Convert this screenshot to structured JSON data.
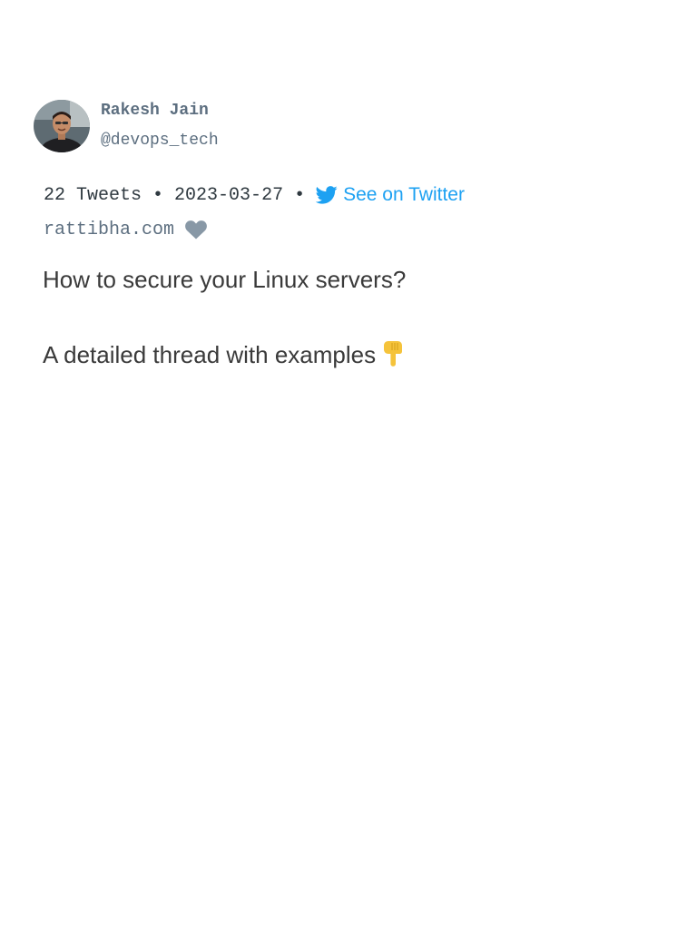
{
  "author": {
    "name": "Rakesh Jain",
    "handle": "@devops_tech",
    "avatar_icon": "profile-photo"
  },
  "meta": {
    "tweet_count": "22 Tweets",
    "separator": "•",
    "date": "2023-03-27",
    "twitter_link_label": "See on Twitter",
    "twitter_icon": "twitter-bird-icon"
  },
  "site": {
    "label": "rattibha.com",
    "heart_icon": "heart-icon"
  },
  "tweet": {
    "line1": "How to secure your Linux servers?",
    "line2": "A detailed thread with examples",
    "emoji_icon": "pointing-down-emoji"
  },
  "colors": {
    "link": "#1da1f2",
    "muted": "#5d6f80",
    "text": "#3a3a3a"
  }
}
